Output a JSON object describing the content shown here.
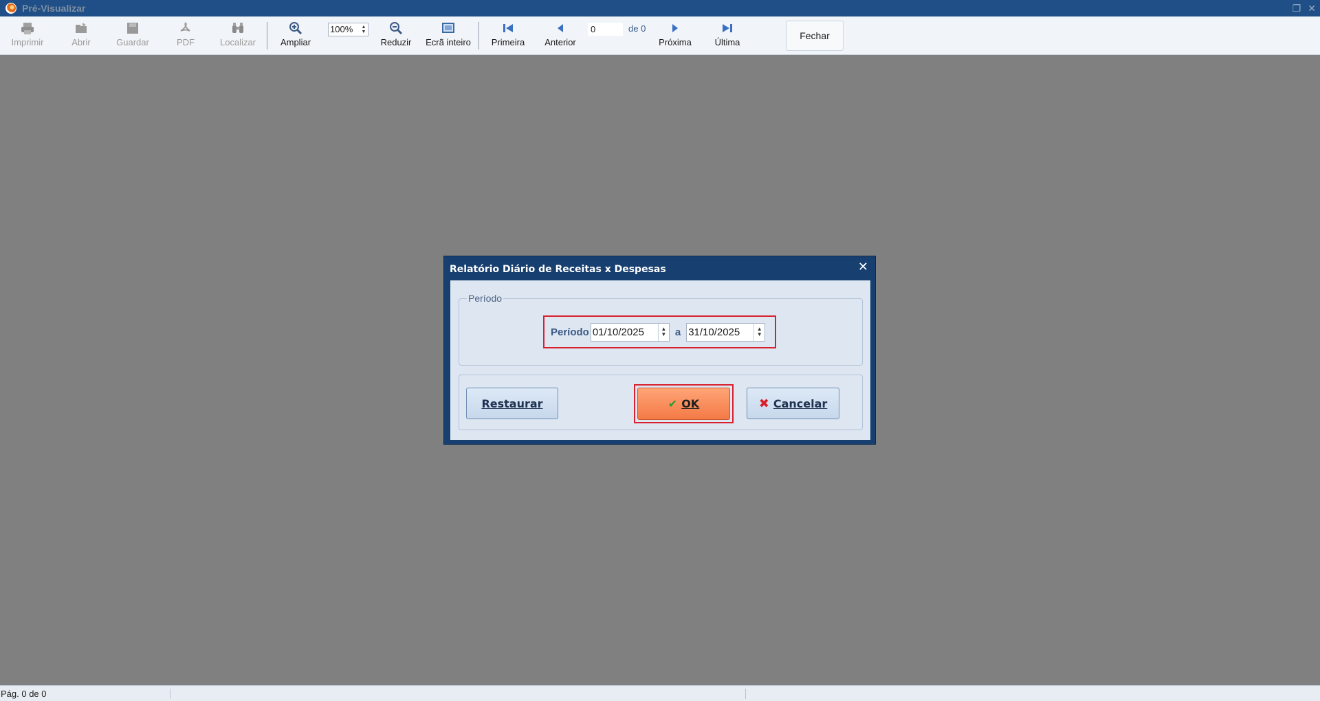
{
  "window": {
    "title": "Pré-Visualizar"
  },
  "toolbar": {
    "imprimir": "Imprimir",
    "abrir": "Abrir",
    "guardar": "Guardar",
    "pdf": "PDF",
    "localizar": "Localizar",
    "ampliar": "Ampliar",
    "zoom_value": "100%",
    "reduzir": "Reduzir",
    "ecra_inteiro": "Ecrã inteiro",
    "primeira": "Primeira",
    "anterior": "Anterior",
    "page_value": "0",
    "page_of": "de 0",
    "proxima": "Próxima",
    "ultima": "Última",
    "fechar": "Fechar"
  },
  "dialog": {
    "title": "Relatório Diário de Receitas x Despesas",
    "group_label": "Período",
    "period_label": "Período",
    "date_from": "01/10/2025",
    "separator": "a",
    "date_to": "31/10/2025",
    "restaurar_label": "Restaurar",
    "ok_label": "OK",
    "cancelar_label": "Cancelar"
  },
  "status": {
    "page_text": "Pág. 0 de 0"
  },
  "colors": {
    "titlebar": "#1f4f86",
    "dialog_border": "#173f70",
    "highlight": "#d9202f",
    "ok_button": "#f47a46",
    "background": "#808080"
  }
}
